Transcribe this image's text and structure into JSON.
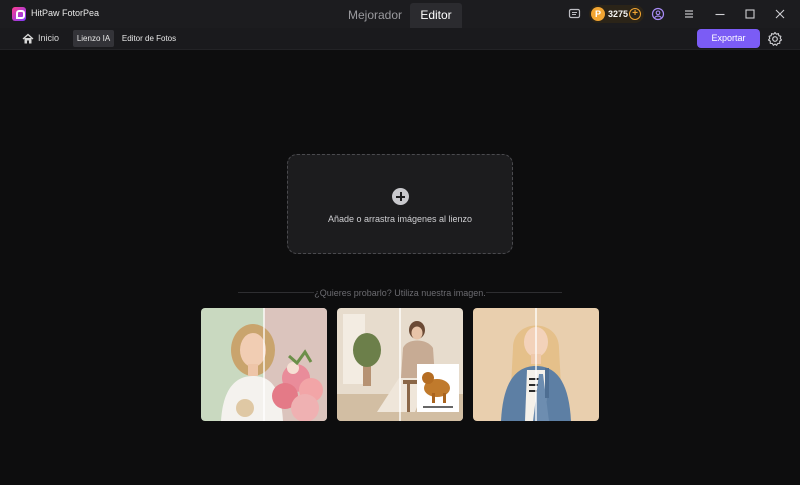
{
  "app": {
    "title": "HitPaw FotorPea",
    "logo_icon": "fotorpea-logo-icon"
  },
  "mode_tabs": [
    {
      "label": "Mejorador",
      "active": false
    },
    {
      "label": "Editor",
      "active": true
    }
  ],
  "titlebar_icons": [
    "chat-icon",
    "user-icon",
    "menu-icon",
    "minimize-icon",
    "maximize-icon",
    "close-icon"
  ],
  "credits": {
    "value": "3275",
    "coin_symbol": "P"
  },
  "toolbar": {
    "home_label": "Inicio",
    "tabs": [
      {
        "label": "Lienzo IA",
        "active": true
      },
      {
        "label": "Editor de Fotos",
        "active": false
      }
    ],
    "export_label": "Exportar"
  },
  "canvas": {
    "drop_text": "Añade o arrastra imágenes al lienzo"
  },
  "samples": {
    "heading": "¿Quieres probarlo? Utiliza nuestra imagen."
  },
  "colors": {
    "accent": "#7b5cf5",
    "coin": "#f2a532",
    "background": "#0d0d0e"
  }
}
